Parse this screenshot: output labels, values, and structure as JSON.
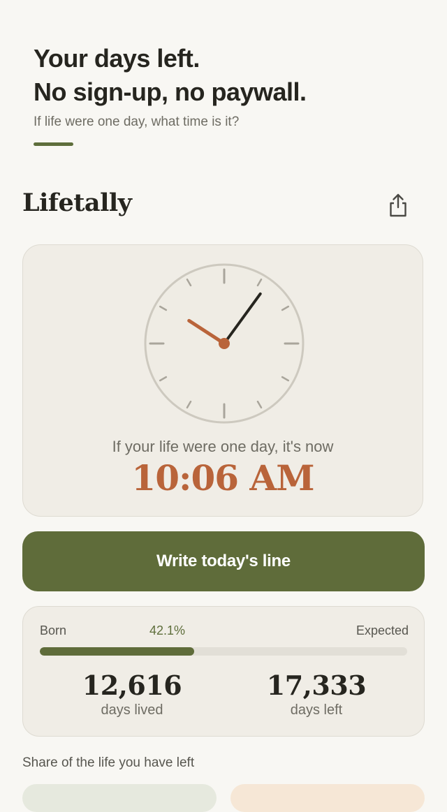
{
  "hero": {
    "line1": "Your days left.",
    "line2": "No sign-up, no paywall.",
    "subtitle": "If life were one day, what time is it?"
  },
  "app": {
    "name": "Lifetally",
    "share_icon": "share-icon"
  },
  "clock": {
    "caption": "If your life were one day, it's now",
    "time": "10:06 AM",
    "hour": 10,
    "minute": 6
  },
  "cta": {
    "label": "Write today's line"
  },
  "stats": {
    "born_label": "Born",
    "percent_label": "42.1%",
    "percent": 42.1,
    "expected_label": "Expected",
    "days_lived": "12,616",
    "days_lived_label": "days lived",
    "days_left": "17,333",
    "days_left_label": "days left"
  },
  "section": {
    "title": "Share of the life you have left"
  },
  "colors": {
    "accent_green": "#5f6c3a",
    "accent_orange": "#b9643a",
    "background": "#f8f7f3"
  }
}
